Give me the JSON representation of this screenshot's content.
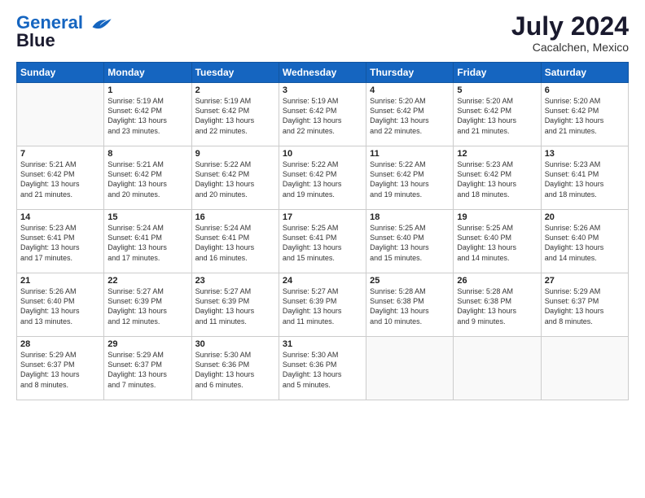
{
  "header": {
    "logo_line1": "General",
    "logo_line2": "Blue",
    "month_year": "July 2024",
    "location": "Cacalchen, Mexico"
  },
  "days_of_week": [
    "Sunday",
    "Monday",
    "Tuesday",
    "Wednesday",
    "Thursday",
    "Friday",
    "Saturday"
  ],
  "weeks": [
    [
      {
        "day": "",
        "info": ""
      },
      {
        "day": "1",
        "info": "Sunrise: 5:19 AM\nSunset: 6:42 PM\nDaylight: 13 hours\nand 23 minutes."
      },
      {
        "day": "2",
        "info": "Sunrise: 5:19 AM\nSunset: 6:42 PM\nDaylight: 13 hours\nand 22 minutes."
      },
      {
        "day": "3",
        "info": "Sunrise: 5:19 AM\nSunset: 6:42 PM\nDaylight: 13 hours\nand 22 minutes."
      },
      {
        "day": "4",
        "info": "Sunrise: 5:20 AM\nSunset: 6:42 PM\nDaylight: 13 hours\nand 22 minutes."
      },
      {
        "day": "5",
        "info": "Sunrise: 5:20 AM\nSunset: 6:42 PM\nDaylight: 13 hours\nand 21 minutes."
      },
      {
        "day": "6",
        "info": "Sunrise: 5:20 AM\nSunset: 6:42 PM\nDaylight: 13 hours\nand 21 minutes."
      }
    ],
    [
      {
        "day": "7",
        "info": "Sunrise: 5:21 AM\nSunset: 6:42 PM\nDaylight: 13 hours\nand 21 minutes."
      },
      {
        "day": "8",
        "info": "Sunrise: 5:21 AM\nSunset: 6:42 PM\nDaylight: 13 hours\nand 20 minutes."
      },
      {
        "day": "9",
        "info": "Sunrise: 5:22 AM\nSunset: 6:42 PM\nDaylight: 13 hours\nand 20 minutes."
      },
      {
        "day": "10",
        "info": "Sunrise: 5:22 AM\nSunset: 6:42 PM\nDaylight: 13 hours\nand 19 minutes."
      },
      {
        "day": "11",
        "info": "Sunrise: 5:22 AM\nSunset: 6:42 PM\nDaylight: 13 hours\nand 19 minutes."
      },
      {
        "day": "12",
        "info": "Sunrise: 5:23 AM\nSunset: 6:42 PM\nDaylight: 13 hours\nand 18 minutes."
      },
      {
        "day": "13",
        "info": "Sunrise: 5:23 AM\nSunset: 6:41 PM\nDaylight: 13 hours\nand 18 minutes."
      }
    ],
    [
      {
        "day": "14",
        "info": "Sunrise: 5:23 AM\nSunset: 6:41 PM\nDaylight: 13 hours\nand 17 minutes."
      },
      {
        "day": "15",
        "info": "Sunrise: 5:24 AM\nSunset: 6:41 PM\nDaylight: 13 hours\nand 17 minutes."
      },
      {
        "day": "16",
        "info": "Sunrise: 5:24 AM\nSunset: 6:41 PM\nDaylight: 13 hours\nand 16 minutes."
      },
      {
        "day": "17",
        "info": "Sunrise: 5:25 AM\nSunset: 6:41 PM\nDaylight: 13 hours\nand 15 minutes."
      },
      {
        "day": "18",
        "info": "Sunrise: 5:25 AM\nSunset: 6:40 PM\nDaylight: 13 hours\nand 15 minutes."
      },
      {
        "day": "19",
        "info": "Sunrise: 5:25 AM\nSunset: 6:40 PM\nDaylight: 13 hours\nand 14 minutes."
      },
      {
        "day": "20",
        "info": "Sunrise: 5:26 AM\nSunset: 6:40 PM\nDaylight: 13 hours\nand 14 minutes."
      }
    ],
    [
      {
        "day": "21",
        "info": "Sunrise: 5:26 AM\nSunset: 6:40 PM\nDaylight: 13 hours\nand 13 minutes."
      },
      {
        "day": "22",
        "info": "Sunrise: 5:27 AM\nSunset: 6:39 PM\nDaylight: 13 hours\nand 12 minutes."
      },
      {
        "day": "23",
        "info": "Sunrise: 5:27 AM\nSunset: 6:39 PM\nDaylight: 13 hours\nand 11 minutes."
      },
      {
        "day": "24",
        "info": "Sunrise: 5:27 AM\nSunset: 6:39 PM\nDaylight: 13 hours\nand 11 minutes."
      },
      {
        "day": "25",
        "info": "Sunrise: 5:28 AM\nSunset: 6:38 PM\nDaylight: 13 hours\nand 10 minutes."
      },
      {
        "day": "26",
        "info": "Sunrise: 5:28 AM\nSunset: 6:38 PM\nDaylight: 13 hours\nand 9 minutes."
      },
      {
        "day": "27",
        "info": "Sunrise: 5:29 AM\nSunset: 6:37 PM\nDaylight: 13 hours\nand 8 minutes."
      }
    ],
    [
      {
        "day": "28",
        "info": "Sunrise: 5:29 AM\nSunset: 6:37 PM\nDaylight: 13 hours\nand 8 minutes."
      },
      {
        "day": "29",
        "info": "Sunrise: 5:29 AM\nSunset: 6:37 PM\nDaylight: 13 hours\nand 7 minutes."
      },
      {
        "day": "30",
        "info": "Sunrise: 5:30 AM\nSunset: 6:36 PM\nDaylight: 13 hours\nand 6 minutes."
      },
      {
        "day": "31",
        "info": "Sunrise: 5:30 AM\nSunset: 6:36 PM\nDaylight: 13 hours\nand 5 minutes."
      },
      {
        "day": "",
        "info": ""
      },
      {
        "day": "",
        "info": ""
      },
      {
        "day": "",
        "info": ""
      }
    ]
  ]
}
